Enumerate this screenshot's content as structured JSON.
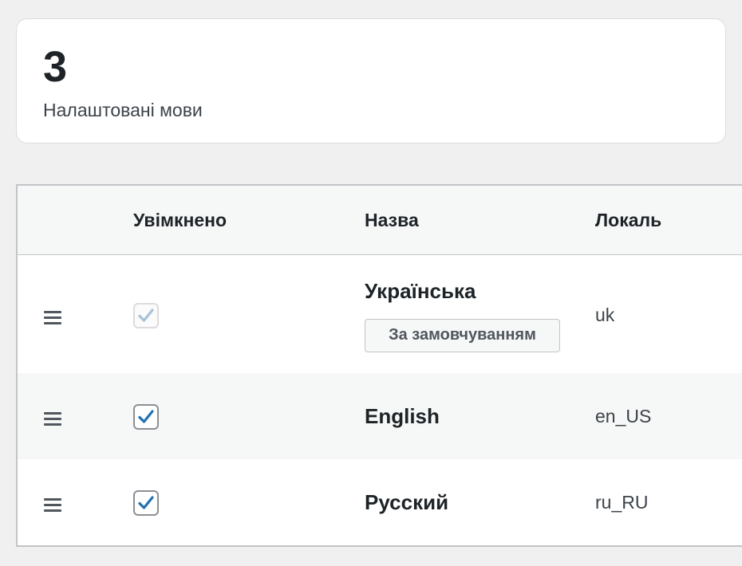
{
  "stats": {
    "count": "3",
    "label": "Налаштовані мови"
  },
  "table": {
    "headers": {
      "enabled": "Увімкнено",
      "name": "Назва",
      "locale": "Локаль"
    },
    "rows": [
      {
        "name": "Українська",
        "locale": "uk",
        "enabled": true,
        "disabled": true,
        "badge": "За замовчуванням"
      },
      {
        "name": "English",
        "locale": "en_US",
        "enabled": true,
        "disabled": false
      },
      {
        "name": "Русский",
        "locale": "ru_RU",
        "enabled": true,
        "disabled": false
      }
    ]
  },
  "colors": {
    "check": "#2271b1",
    "check_disabled": "#a7c1d9"
  },
  "icons": {
    "drag": "drag-handle-icon",
    "check": "checkmark-icon"
  }
}
